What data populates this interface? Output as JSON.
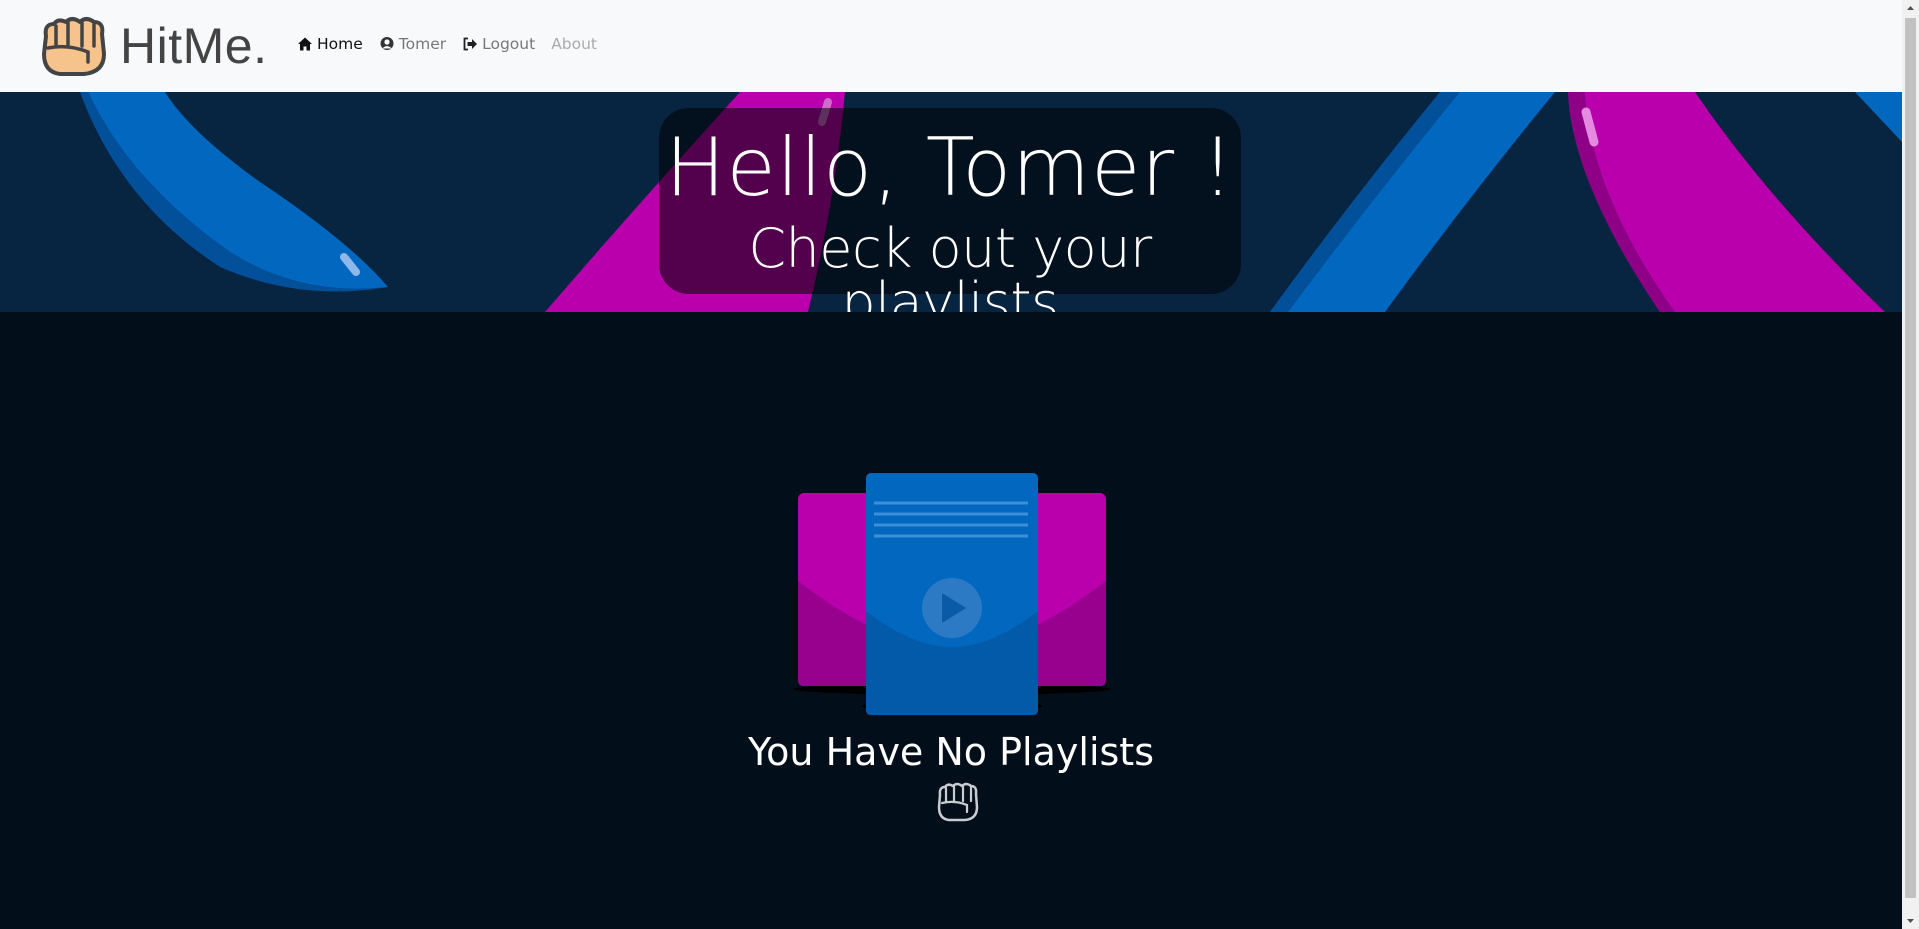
{
  "brand": {
    "name": "HitMe.",
    "logo_icon": "fist-icon"
  },
  "nav": {
    "items": [
      {
        "label": "Home",
        "icon": "home-icon",
        "state": "active"
      },
      {
        "label": "Tomer",
        "icon": "user-icon",
        "state": "normal"
      },
      {
        "label": "Logout",
        "icon": "logout-icon",
        "state": "normal"
      },
      {
        "label": "About",
        "icon": "",
        "state": "disabled"
      }
    ]
  },
  "hero": {
    "greeting": "Hello, Tomer !",
    "subtitle": "Check out your playlists"
  },
  "main": {
    "empty_message": "You Have No Playlists",
    "empty_icon": "fist-icon"
  },
  "colors": {
    "navbar_bg": "#f8f9fa",
    "hero_bg": "#072440",
    "page_bg": "#020f1a",
    "accent_blue": "#0167bf",
    "accent_magenta": "#b900ac"
  }
}
